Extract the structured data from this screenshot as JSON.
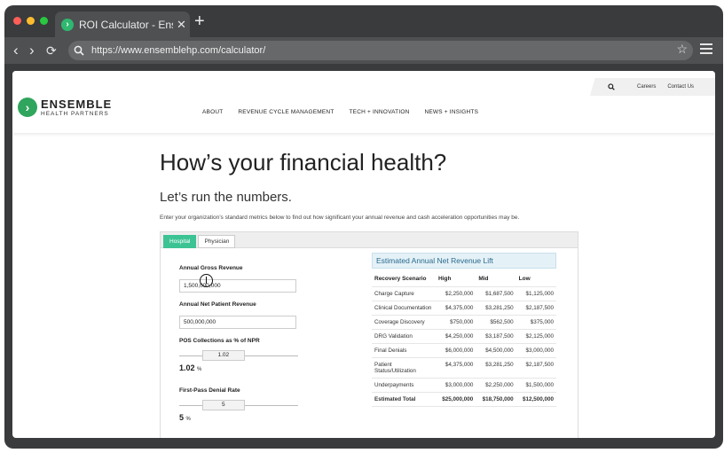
{
  "browser": {
    "tab_title": "ROI Calculator - Ense",
    "tab_close": "✕",
    "new_tab": "+",
    "url": "https://www.ensemblehp.com/calculator/",
    "colors": {
      "close": "#ff5f57",
      "minimize": "#febc2e",
      "zoom": "#28c840"
    }
  },
  "site": {
    "logo_line1": "ENSEMBLE",
    "logo_line2": "HEALTH PARTNERS",
    "nav": [
      "ABOUT",
      "REVENUE CYCLE MANAGEMENT",
      "TECH + INNOVATION",
      "NEWS + INSIGHTS"
    ],
    "utility": {
      "careers": "Careers",
      "contact": "Contact Us"
    },
    "accent": "#3cc394"
  },
  "page": {
    "title": "How’s your financial health?",
    "subtitle": "Let’s run the numbers.",
    "intro": "Enter your organization’s standard metrics below to find out how significant your annual revenue and cash acceleration opportunities may be."
  },
  "calculator": {
    "tabs": [
      "Hospital",
      "Physician"
    ],
    "fields": {
      "gross_label": "Annual Gross Revenue",
      "gross_value": "1,500,000,000",
      "npr_label": "Annual Net Patient Revenue",
      "npr_value": "500,000,000",
      "pos_label": "POS Collections as % of NPR",
      "pos_slider": "1.02",
      "pos_value": "1.02",
      "pos_unit": "%",
      "pos_level": 0.3,
      "denial_label": "First-Pass Denial Rate",
      "denial_slider": "5",
      "denial_value": "5",
      "denial_unit": "%",
      "denial_level": 0.3
    },
    "results": {
      "title": "Estimated Annual Net Revenue Lift",
      "headers": [
        "Recovery Scenario",
        "High",
        "Mid",
        "Low"
      ],
      "rows": [
        [
          "Charge Capture",
          "$2,250,000",
          "$1,687,500",
          "$1,125,000"
        ],
        [
          "Clinical Documentation",
          "$4,375,000",
          "$3,281,250",
          "$2,187,500"
        ],
        [
          "Coverage Discovery",
          "$750,000",
          "$562,500",
          "$375,000"
        ],
        [
          "DRG Validation",
          "$4,250,000",
          "$3,187,500",
          "$2,125,000"
        ],
        [
          "Final Denials",
          "$6,000,000",
          "$4,500,000",
          "$3,000,000"
        ],
        [
          "Patient Status/Utilization",
          "$4,375,000",
          "$3,281,250",
          "$2,187,500"
        ],
        [
          "Underpayments",
          "$3,000,000",
          "$2,250,000",
          "$1,500,000"
        ]
      ],
      "total": [
        "Estimated Total",
        "$25,000,000",
        "$18,750,000",
        "$12,500,000"
      ]
    }
  }
}
